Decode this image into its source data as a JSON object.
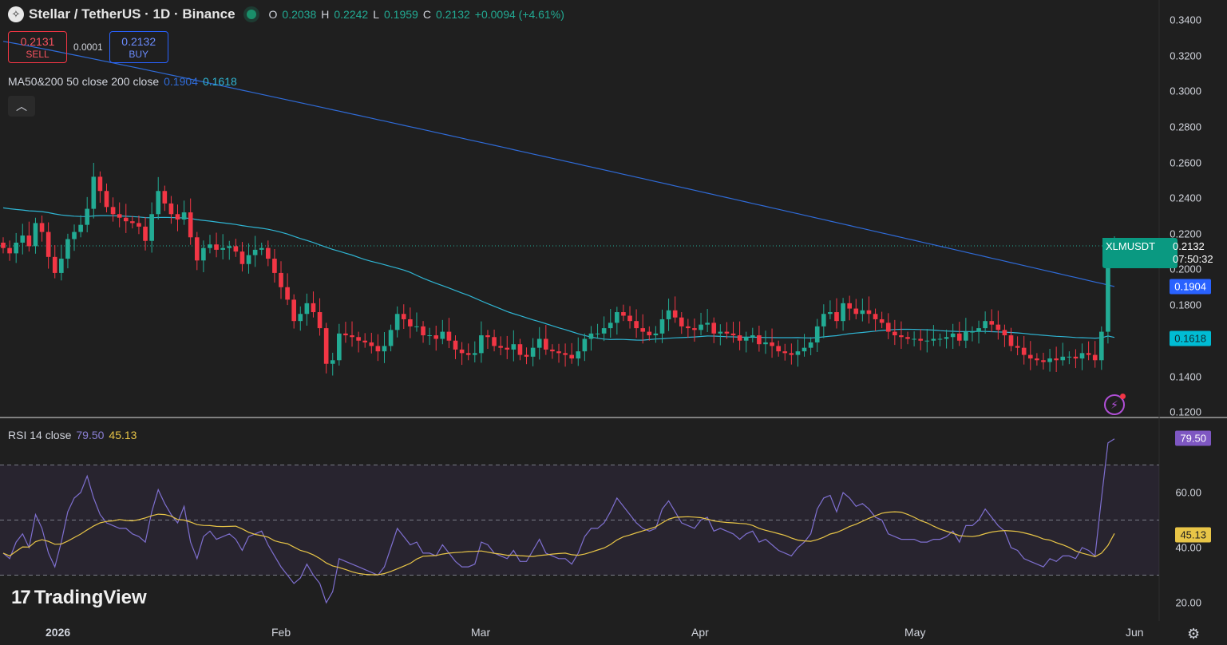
{
  "header": {
    "symbol_icon": "stellar-icon",
    "title": "Stellar / TetherUS · 1D · Binance",
    "ohlc": {
      "o_key": "O",
      "o": "0.2038",
      "h_key": "H",
      "h": "0.2242",
      "l_key": "L",
      "l": "0.1959",
      "c_key": "C",
      "c": "0.2132",
      "change": "+0.0094 (+4.61%)"
    }
  },
  "trade": {
    "sell_price": "0.2131",
    "sell_label": "SELL",
    "spread": "0.0001",
    "buy_price": "0.2132",
    "buy_label": "BUY"
  },
  "ma_legend": {
    "label": "MA50&200 50 close 200 close",
    "ma50": "0.1904",
    "ma200": "0.1618"
  },
  "rsi_legend": {
    "label": "RSI 14 close",
    "rsi": "79.50",
    "rsi_ma": "45.13"
  },
  "price_axis": [
    "0.3400",
    "0.3200",
    "0.3000",
    "0.2800",
    "0.2600",
    "0.2400",
    "0.2200",
    "0.2000",
    "0.1800",
    "0.1400",
    "0.1200"
  ],
  "rsi_axis": [
    "60.00",
    "40.00",
    "20.00"
  ],
  "time_axis": [
    "2026",
    "Feb",
    "Mar",
    "Apr",
    "May",
    "Jun"
  ],
  "tags": {
    "symbol": "XLMUSDT",
    "last_price": "0.2132",
    "countdown": "07:50:32",
    "ma50": "0.1904",
    "ma200": "0.1618",
    "rsi": "79.50",
    "rsi_ma": "45.13"
  },
  "logo_text": "TradingView",
  "colors": {
    "up": "#22ab94",
    "down": "#f23645",
    "ma50": "#2f6bd8",
    "ma200": "#2fb5d3",
    "rsi": "#7e6fcf",
    "rsi_ma": "#e8c547",
    "background": "#1f1f1f"
  },
  "chart_data": {
    "type": "candlestick",
    "price_range": [
      0.12,
      0.345
    ],
    "rsi_range": [
      15,
      85
    ],
    "rsi_levels": [
      70,
      50,
      30
    ],
    "closes": [
      0.212,
      0.209,
      0.215,
      0.219,
      0.213,
      0.226,
      0.221,
      0.207,
      0.198,
      0.206,
      0.217,
      0.221,
      0.225,
      0.234,
      0.252,
      0.244,
      0.235,
      0.231,
      0.229,
      0.227,
      0.226,
      0.224,
      0.216,
      0.231,
      0.244,
      0.237,
      0.231,
      0.228,
      0.232,
      0.218,
      0.205,
      0.212,
      0.214,
      0.211,
      0.212,
      0.213,
      0.21,
      0.203,
      0.208,
      0.211,
      0.212,
      0.206,
      0.198,
      0.19,
      0.183,
      0.171,
      0.175,
      0.181,
      0.176,
      0.167,
      0.147,
      0.149,
      0.164,
      0.163,
      0.162,
      0.16,
      0.159,
      0.157,
      0.154,
      0.157,
      0.166,
      0.175,
      0.172,
      0.168,
      0.168,
      0.163,
      0.163,
      0.161,
      0.165,
      0.16,
      0.155,
      0.153,
      0.152,
      0.153,
      0.163,
      0.162,
      0.157,
      0.156,
      0.155,
      0.158,
      0.152,
      0.151,
      0.156,
      0.161,
      0.155,
      0.154,
      0.153,
      0.152,
      0.15,
      0.154,
      0.161,
      0.164,
      0.164,
      0.167,
      0.17,
      0.176,
      0.174,
      0.171,
      0.167,
      0.165,
      0.163,
      0.164,
      0.172,
      0.177,
      0.173,
      0.168,
      0.167,
      0.166,
      0.169,
      0.17,
      0.164,
      0.165,
      0.164,
      0.163,
      0.16,
      0.162,
      0.163,
      0.158,
      0.159,
      0.157,
      0.154,
      0.153,
      0.152,
      0.154,
      0.156,
      0.159,
      0.168,
      0.175,
      0.176,
      0.171,
      0.181,
      0.178,
      0.175,
      0.177,
      0.175,
      0.172,
      0.17,
      0.165,
      0.163,
      0.162,
      0.161,
      0.161,
      0.16,
      0.16,
      0.161,
      0.161,
      0.162,
      0.164,
      0.16,
      0.165,
      0.165,
      0.167,
      0.171,
      0.169,
      0.166,
      0.163,
      0.157,
      0.156,
      0.152,
      0.15,
      0.149,
      0.148,
      0.15,
      0.149,
      0.151,
      0.151,
      0.15,
      0.153,
      0.152,
      0.149,
      0.165,
      0.203,
      0.2132
    ],
    "opens": [
      0.215,
      0.212,
      0.209,
      0.215,
      0.219,
      0.213,
      0.226,
      0.221,
      0.207,
      0.198,
      0.206,
      0.217,
      0.221,
      0.225,
      0.234,
      0.252,
      0.244,
      0.235,
      0.231,
      0.229,
      0.227,
      0.226,
      0.224,
      0.216,
      0.231,
      0.244,
      0.237,
      0.231,
      0.228,
      0.232,
      0.218,
      0.205,
      0.212,
      0.214,
      0.211,
      0.212,
      0.213,
      0.21,
      0.203,
      0.208,
      0.211,
      0.212,
      0.206,
      0.198,
      0.19,
      0.183,
      0.171,
      0.175,
      0.181,
      0.176,
      0.167,
      0.147,
      0.149,
      0.164,
      0.163,
      0.162,
      0.16,
      0.159,
      0.157,
      0.154,
      0.157,
      0.166,
      0.175,
      0.172,
      0.168,
      0.168,
      0.163,
      0.163,
      0.161,
      0.165,
      0.16,
      0.155,
      0.153,
      0.152,
      0.153,
      0.163,
      0.162,
      0.157,
      0.156,
      0.155,
      0.158,
      0.152,
      0.151,
      0.156,
      0.161,
      0.155,
      0.154,
      0.153,
      0.152,
      0.15,
      0.154,
      0.161,
      0.164,
      0.164,
      0.167,
      0.17,
      0.176,
      0.174,
      0.171,
      0.167,
      0.165,
      0.163,
      0.164,
      0.172,
      0.177,
      0.173,
      0.168,
      0.167,
      0.166,
      0.169,
      0.17,
      0.164,
      0.165,
      0.164,
      0.163,
      0.16,
      0.162,
      0.163,
      0.158,
      0.159,
      0.157,
      0.154,
      0.153,
      0.152,
      0.154,
      0.156,
      0.159,
      0.168,
      0.175,
      0.176,
      0.171,
      0.181,
      0.178,
      0.175,
      0.177,
      0.175,
      0.172,
      0.17,
      0.165,
      0.163,
      0.162,
      0.161,
      0.161,
      0.16,
      0.16,
      0.161,
      0.161,
      0.162,
      0.164,
      0.16,
      0.165,
      0.165,
      0.167,
      0.171,
      0.169,
      0.166,
      0.163,
      0.157,
      0.156,
      0.152,
      0.15,
      0.149,
      0.148,
      0.15,
      0.149,
      0.151,
      0.151,
      0.15,
      0.153,
      0.152,
      0.149,
      0.165,
      0.2038
    ],
    "rsi": [
      38,
      36,
      42,
      45,
      40,
      52,
      47,
      38,
      33,
      42,
      53,
      58,
      60,
      66,
      58,
      52,
      49,
      48,
      47,
      47,
      45,
      44,
      42,
      53,
      61,
      56,
      52,
      49,
      55,
      42,
      36,
      44,
      46,
      43,
      44,
      45,
      43,
      39,
      44,
      45,
      46,
      41,
      37,
      33,
      30,
      27,
      29,
      34,
      30,
      27,
      20,
      24,
      36,
      35,
      34,
      33,
      32,
      31,
      30,
      33,
      40,
      47,
      44,
      41,
      42,
      38,
      38,
      37,
      41,
      38,
      35,
      33,
      33,
      34,
      42,
      41,
      38,
      37,
      36,
      39,
      35,
      35,
      39,
      43,
      38,
      37,
      36,
      36,
      34,
      38,
      44,
      47,
      47,
      49,
      53,
      58,
      55,
      52,
      49,
      47,
      46,
      47,
      54,
      57,
      53,
      49,
      48,
      47,
      50,
      51,
      46,
      47,
      46,
      45,
      43,
      45,
      46,
      42,
      43,
      41,
      39,
      38,
      37,
      40,
      42,
      45,
      54,
      58,
      59,
      53,
      60,
      58,
      55,
      56,
      54,
      51,
      50,
      45,
      44,
      43,
      43,
      43,
      42,
      42,
      43,
      43,
      44,
      46,
      42,
      48,
      48,
      50,
      54,
      51,
      48,
      46,
      40,
      39,
      36,
      35,
      34,
      33,
      36,
      35,
      37,
      37,
      36,
      40,
      39,
      37,
      58,
      78,
      79.5
    ]
  }
}
